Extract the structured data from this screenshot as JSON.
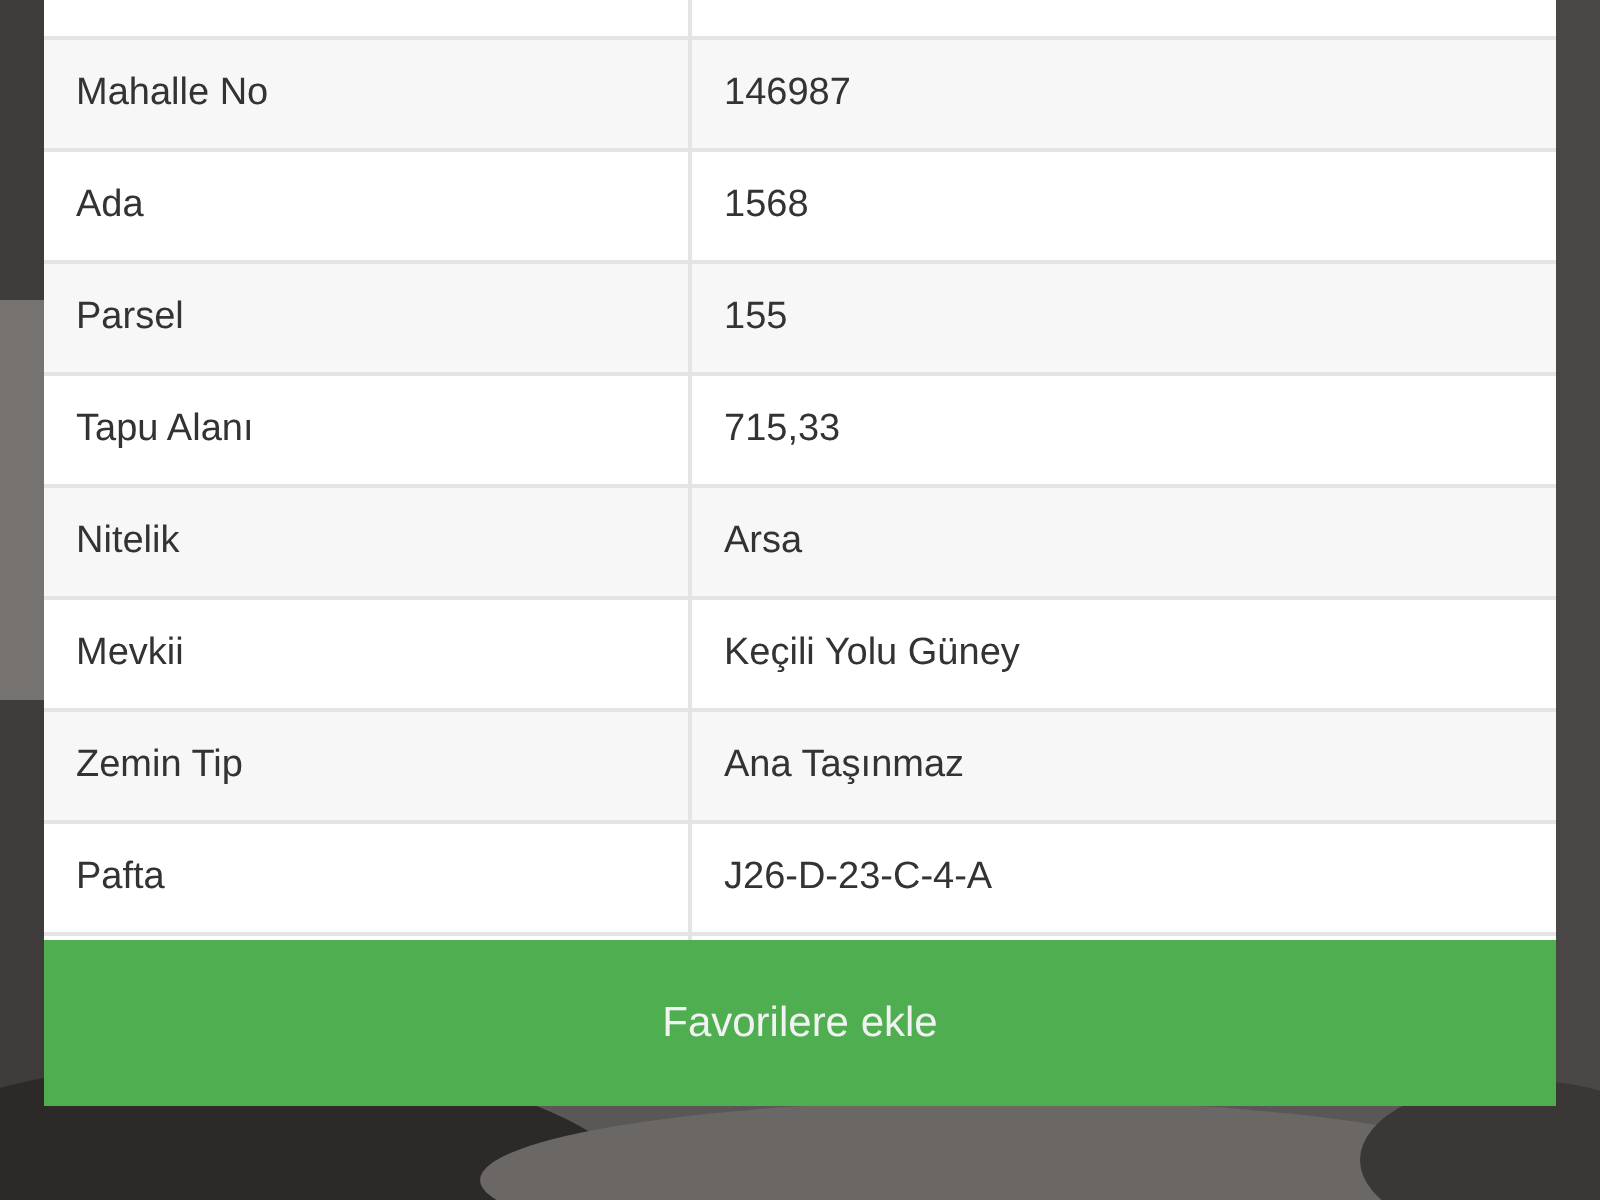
{
  "table": {
    "rows": [
      {
        "label": "Mahalle No",
        "value": "146987"
      },
      {
        "label": "Ada",
        "value": "1568"
      },
      {
        "label": "Parsel",
        "value": "155"
      },
      {
        "label": "Tapu Alanı",
        "value": "715,33"
      },
      {
        "label": "Nitelik",
        "value": "Arsa"
      },
      {
        "label": "Mevkii",
        "value": "Keçili Yolu Güney"
      },
      {
        "label": "Zemin Tip",
        "value": "Ana Taşınmaz"
      },
      {
        "label": "Pafta",
        "value": "J26-D-23-C-4-A"
      }
    ]
  },
  "button": {
    "label": "Favorilere ekle"
  }
}
